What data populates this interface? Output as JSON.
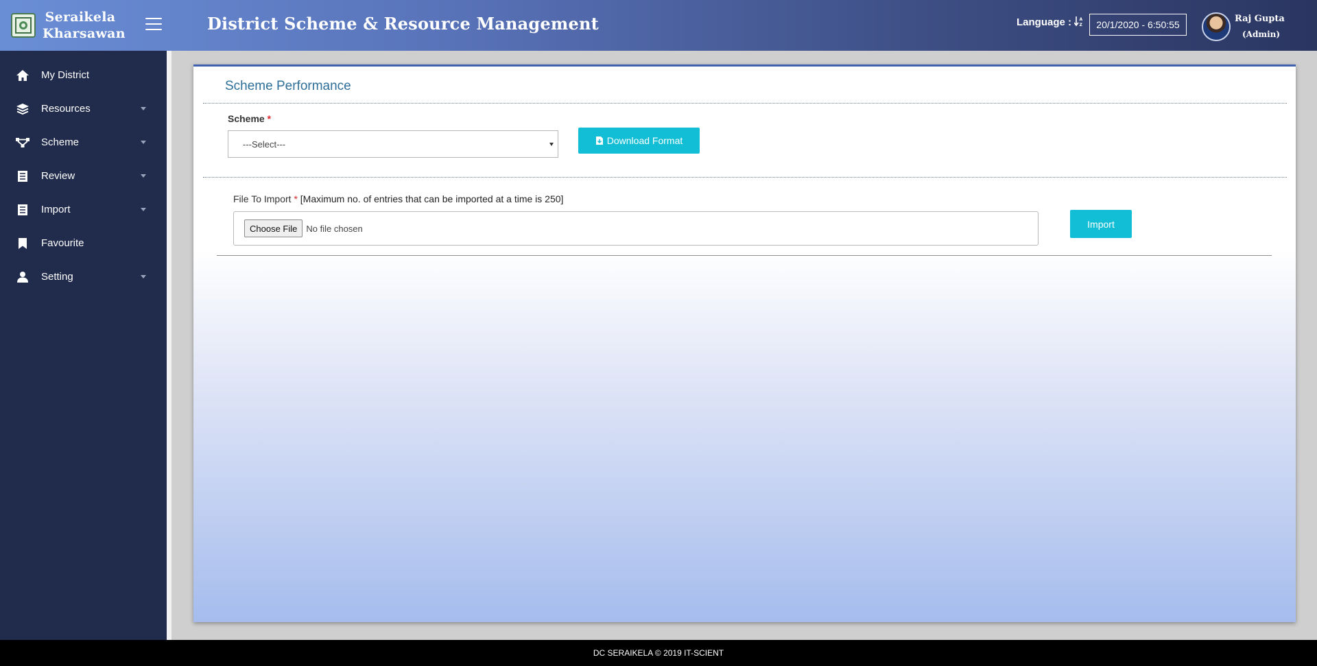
{
  "brand": {
    "line1": "Seraikela",
    "line2": "Kharsawan"
  },
  "header": {
    "title": "District Scheme & Resource Management",
    "language_label": "Language :",
    "datetime": "20/1/2020 - 6:50:55",
    "user_name": "Raj Gupta",
    "user_role": "(Admin)"
  },
  "sidebar": {
    "items": [
      {
        "label": "My District",
        "icon": "home-icon",
        "has_caret": false
      },
      {
        "label": "Resources",
        "icon": "layers-icon",
        "has_caret": true
      },
      {
        "label": "Scheme",
        "icon": "network-icon",
        "has_caret": true
      },
      {
        "label": "Review",
        "icon": "list-icon",
        "has_caret": true
      },
      {
        "label": "Import",
        "icon": "list-icon",
        "has_caret": true
      },
      {
        "label": "Favourite",
        "icon": "bookmark-icon",
        "has_caret": false
      },
      {
        "label": "Setting",
        "icon": "user-icon",
        "has_caret": true
      }
    ]
  },
  "main": {
    "title": "Scheme Performance",
    "scheme_label": "Scheme",
    "required_mark": "*",
    "scheme_select_value": "---Select---",
    "download_button": "Download Format",
    "file_label": "File To Import",
    "file_note": "[Maximum no. of entries that can be imported at a time is 250]",
    "choose_file": "Choose File",
    "no_file": "No file chosen",
    "import_button": "Import"
  },
  "footer": {
    "text": "DC SERAIKELA © 2019 IT-SCIENT"
  },
  "colors": {
    "accent": "#12bed6",
    "sidebar": "#212c4c",
    "title": "#2d6f99",
    "required": "#e0262b"
  }
}
